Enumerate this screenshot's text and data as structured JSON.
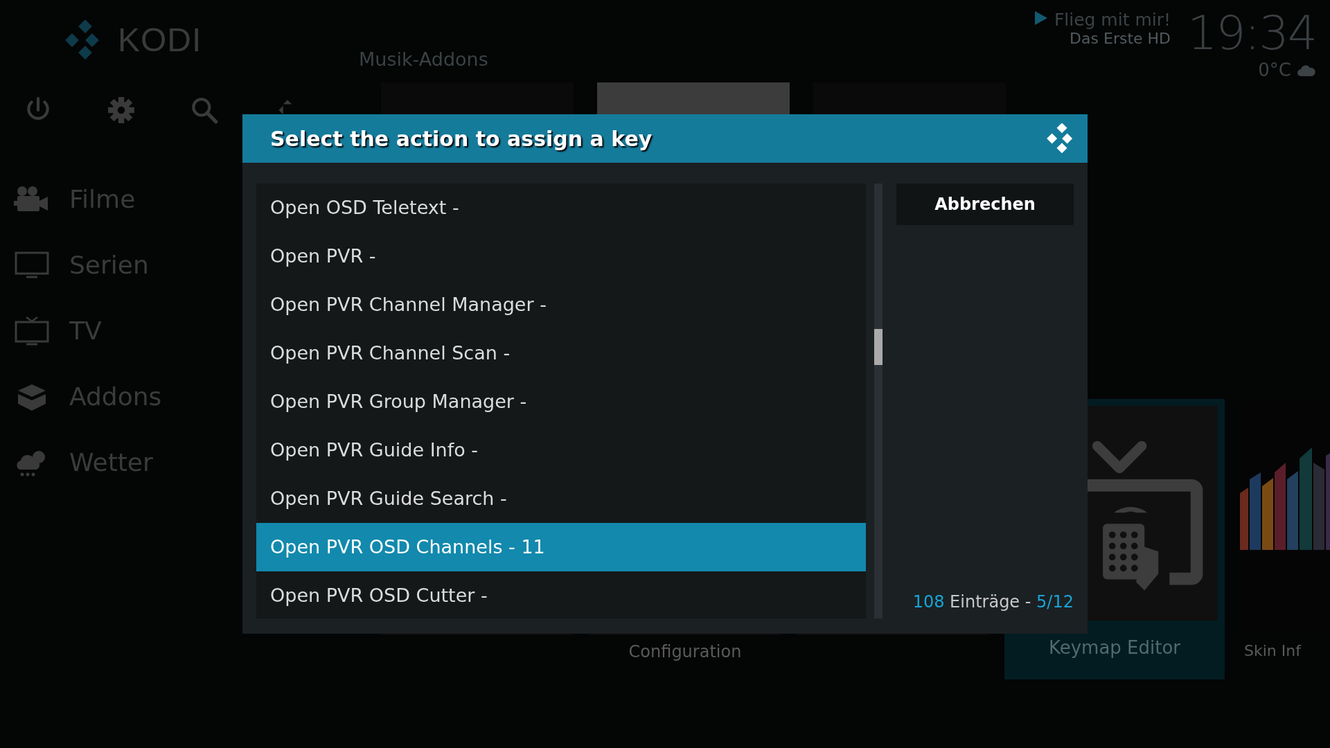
{
  "sidebar": {
    "logo": "KODI",
    "menu": [
      {
        "label": "Filme"
      },
      {
        "label": "Serien"
      },
      {
        "label": "TV"
      },
      {
        "label": "Addons"
      },
      {
        "label": "Wetter"
      }
    ]
  },
  "now_playing": {
    "title": "Flieg mit mir!",
    "channel": "Das Erste HD"
  },
  "clock": "19:34",
  "weather": {
    "temperature": "0°C"
  },
  "section_title": "Musik-Addons",
  "tiles": [
    {
      "label": "Configuration",
      "selected": false
    },
    {
      "label": "Keymap Editor",
      "selected": true
    },
    {
      "label": "Skin Inf",
      "selected": false
    }
  ],
  "dialog": {
    "title": "Select the action to assign a key",
    "items": [
      {
        "label": "Open OSD Teletext -",
        "selected": false
      },
      {
        "label": "Open PVR -",
        "selected": false
      },
      {
        "label": "Open PVR Channel Manager -",
        "selected": false
      },
      {
        "label": "Open PVR Channel Scan -",
        "selected": false
      },
      {
        "label": "Open PVR Group Manager -",
        "selected": false
      },
      {
        "label": "Open PVR Guide Info -",
        "selected": false
      },
      {
        "label": "Open PVR Guide Search -",
        "selected": false
      },
      {
        "label": "Open PVR OSD Channels - 11",
        "selected": true
      },
      {
        "label": "Open PVR OSD Cutter -",
        "selected": false
      }
    ],
    "cancel_button": "Abbrechen",
    "footer": {
      "count": "108",
      "label": "Einträge",
      "separator": "-",
      "page": "5/12"
    }
  }
}
